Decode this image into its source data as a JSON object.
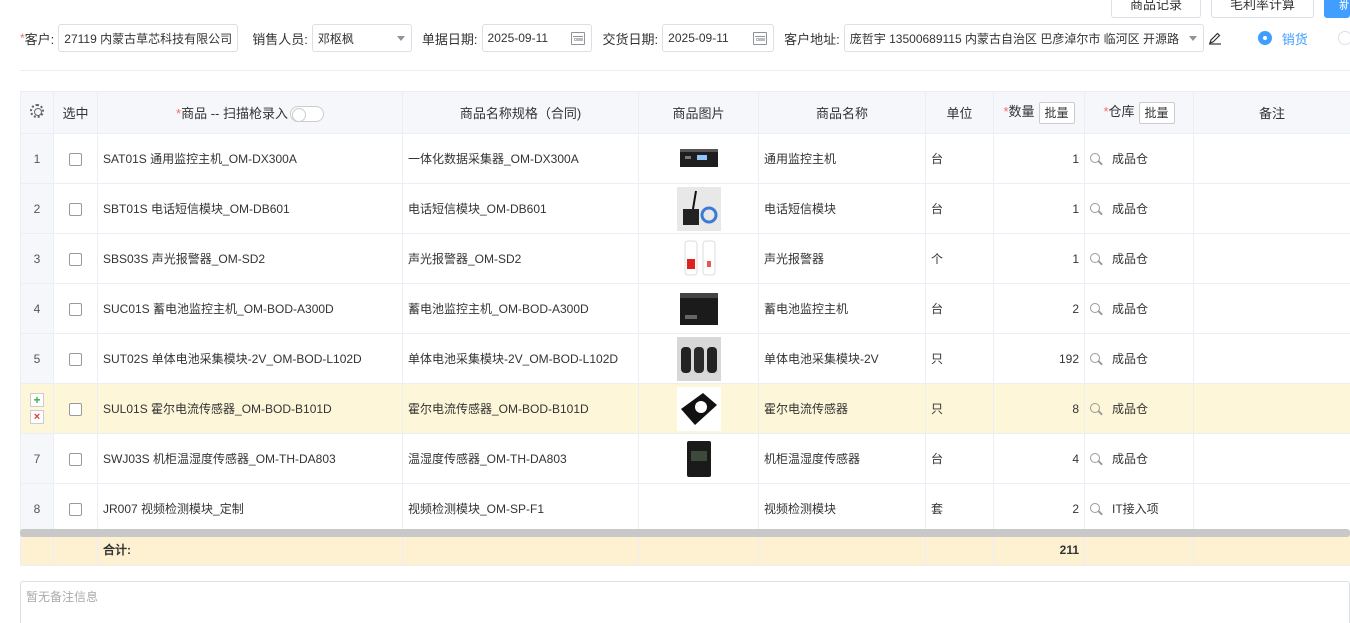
{
  "toolbar": {
    "buttons": [
      "商品记录",
      "毛利率计算",
      "新"
    ]
  },
  "form": {
    "customer_label": "客户:",
    "customer_value": "27119 内蒙古草芯科技有限公司",
    "salesperson_label": "销售人员:",
    "salesperson_value": "邓枢枫",
    "doc_date_label": "单据日期:",
    "doc_date_value": "2025-09-11",
    "delivery_date_label": "交货日期:",
    "delivery_date_value": "2025-09-11",
    "address_label": "客户地址:",
    "address_value": "庞哲宇 13500689115 内蒙古自治区 巴彦淖尔市 临河区 开源路",
    "radio_sale_label": "销货"
  },
  "table": {
    "columns": {
      "select": "选中",
      "product": "商品 -- 扫描枪录入",
      "spec": "商品名称规格（合同)",
      "image": "商品图片",
      "name": "商品名称",
      "unit": "单位",
      "qty": "数量",
      "warehouse": "仓库",
      "remark": "备注",
      "batch": "批量"
    },
    "rows": [
      {
        "idx": "1",
        "product": "SAT01S 通用监控主机_OM-DX300A",
        "spec": "一体化数据采集器_OM-DX300A",
        "name": "通用监控主机",
        "unit": "台",
        "qty": "1",
        "warehouse": "成品仓",
        "img": "host"
      },
      {
        "idx": "2",
        "product": "SBT01S 电话短信模块_OM-DB601",
        "spec": "电话短信模块_OM-DB601",
        "name": "电话短信模块",
        "unit": "台",
        "qty": "1",
        "warehouse": "成品仓",
        "img": "sms"
      },
      {
        "idx": "3",
        "product": "SBS03S 声光报警器_OM-SD2",
        "spec": "声光报警器_OM-SD2",
        "name": "声光报警器",
        "unit": "个",
        "qty": "1",
        "warehouse": "成品仓",
        "img": "alarm"
      },
      {
        "idx": "4",
        "product": "SUC01S 蓄电池监控主机_OM-BOD-A300D",
        "spec": "蓄电池监控主机_OM-BOD-A300D",
        "name": "蓄电池监控主机",
        "unit": "台",
        "qty": "2",
        "warehouse": "成品仓",
        "img": "rack"
      },
      {
        "idx": "5",
        "product": "SUT02S 单体电池采集模块-2V_OM-BOD-L102D",
        "spec": "单体电池采集模块-2V_OM-BOD-L102D",
        "name": "单体电池采集模块-2V",
        "unit": "只",
        "qty": "192",
        "warehouse": "成品仓",
        "img": "cells"
      },
      {
        "idx": "",
        "product": "SUL01S 霍尔电流传感器_OM-BOD-B101D",
        "spec": "霍尔电流传感器_OM-BOD-B101D",
        "name": "霍尔电流传感器",
        "unit": "只",
        "qty": "8",
        "warehouse": "成品仓",
        "img": "hall"
      },
      {
        "idx": "7",
        "product": "SWJ03S 机柜温湿度传感器_OM-TH-DA803",
        "spec": "温湿度传感器_OM-TH-DA803",
        "name": "机柜温湿度传感器",
        "unit": "台",
        "qty": "4",
        "warehouse": "成品仓",
        "img": "th"
      },
      {
        "idx": "8",
        "product": "JR007 视频检测模块_定制",
        "spec": "视频检测模块_OM-SP-F1",
        "name": "视频检测模块",
        "unit": "套",
        "qty": "2",
        "warehouse": "IT接入项",
        "img": ""
      }
    ],
    "total_label": "合计:",
    "total_qty": "211"
  },
  "remark_placeholder": "暂无备注信息",
  "colors": {
    "accent": "#409eff",
    "required": "#f56c6c",
    "highlight_row": "#fdf6d8",
    "total_row": "#fdf1d2"
  }
}
